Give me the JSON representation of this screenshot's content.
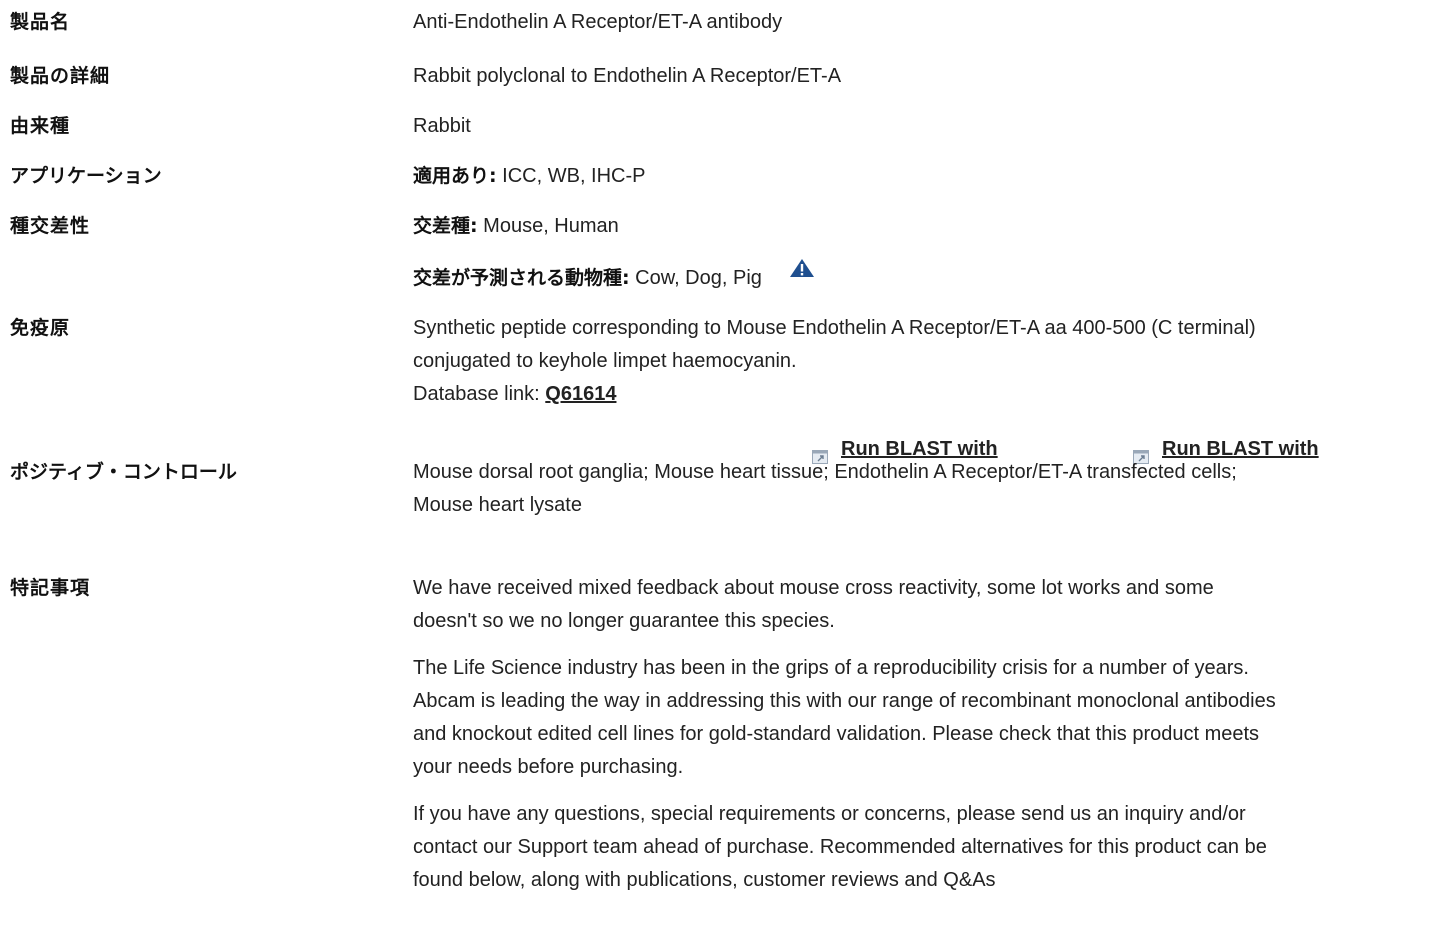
{
  "rows": {
    "product_name": {
      "label": "製品名",
      "value": "Anti-Endothelin A Receptor/ET-A antibody"
    },
    "product_detail": {
      "label": "製品の詳細",
      "value": "Rabbit polyclonal to Endothelin A Receptor/ET-A"
    },
    "host": {
      "label": "由来種",
      "value": "Rabbit"
    },
    "applications": {
      "label": "アプリケーション",
      "prefix": "適用あり:",
      "value": " ICC, WB, IHC-P"
    },
    "reactivity": {
      "label": "種交差性",
      "reacts_prefix": "交差種:",
      "reacts_value": " Mouse, Human",
      "predicted_prefix": "交差が予測される動物種:",
      "predicted_value": " Cow, Dog, Pig",
      "warning_icon": "warning-triangle-icon"
    },
    "immunogen": {
      "label": "免疫原",
      "line1": "Synthetic peptide corresponding to Mouse Endothelin A Receptor/ET-A aa 400-500 (C terminal)",
      "line2": "conjugated to keyhole limpet haemocyanin.",
      "db_prefix": "Database link: ",
      "db_link": "Q61614",
      "blast1": "Run BLAST with",
      "blast2": "Run BLAST with",
      "blast_icon": "external-window-icon"
    },
    "positive_control": {
      "label": "ポジティブ・コントロール",
      "line1": "Mouse dorsal root ganglia; Mouse heart tissue; Endothelin A Receptor/ET-A transfected cells;",
      "line2": "Mouse heart lysate"
    },
    "notes": {
      "label": "特記事項",
      "p1_line1": "We have received mixed feedback about mouse cross reactivity, some lot works and some",
      "p1_line2": "doesn't so we no longer guarantee this species.",
      "p2_line1": "The Life Science industry has been in the grips of a reproducibility crisis for a number of years.",
      "p2_line2": "Abcam is leading the way in addressing this with our range of recombinant monoclonal antibodies",
      "p2_line3": "and knockout edited cell lines for gold-standard validation. Please check that this product meets",
      "p2_line4": "your needs before purchasing.",
      "p3_line1": "If you have any questions, special requirements or concerns, please send us an inquiry and/or",
      "p3_line2": "contact our Support team ahead of purchase. Recommended alternatives for this product can be",
      "p3_line3": "found below, along with publications, customer reviews and Q&As"
    }
  },
  "colors": {
    "text": "#222222",
    "label": "#111111",
    "warning_icon": "#1f4f8f"
  }
}
